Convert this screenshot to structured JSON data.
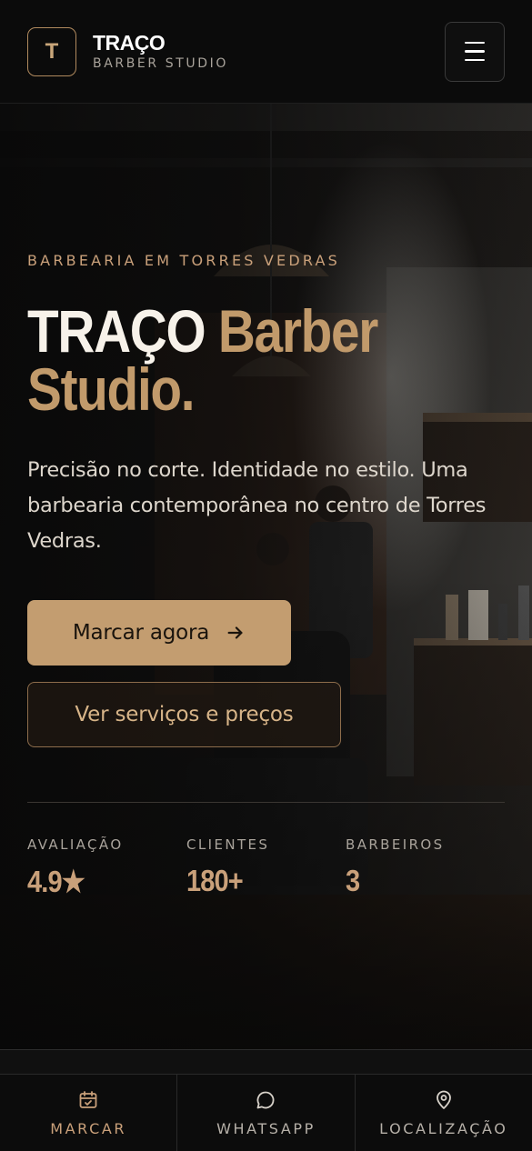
{
  "header": {
    "logo_letter": "T",
    "brand_name": "TRAÇO",
    "brand_sub": "BARBER STUDIO",
    "menu_icon": "hamburger-icon"
  },
  "hero": {
    "eyebrow": "BARBEARIA EM TORRES VEDRAS",
    "title_white": "TRAÇO",
    "title_gold_1": "Barber",
    "title_gold_2": "Studio.",
    "description": "Precisão no corte. Identidade no estilo. Uma barbearia contemporânea no centro de Torres Vedras.",
    "primary_button": "Marcar agora",
    "primary_button_icon": "arrow-right-icon",
    "secondary_button": "Ver serviços e preços",
    "stats": [
      {
        "label": "AVALIAÇÃO",
        "value": "4.9★"
      },
      {
        "label": "CLIENTES",
        "value": "180+"
      },
      {
        "label": "BARBEIROS",
        "value": "3"
      }
    ]
  },
  "bottom_nav": {
    "items": [
      {
        "label": "MARCAR",
        "icon": "calendar-check-icon",
        "active": true
      },
      {
        "label": "WHATSAPP",
        "icon": "chat-bubble-icon",
        "active": false
      },
      {
        "label": "LOCALIZAÇÃO",
        "icon": "map-pin-icon",
        "active": false
      }
    ]
  },
  "colors": {
    "accent": "#c39d70",
    "accent_text": "#c9a07a",
    "background": "#0b0b0b"
  }
}
